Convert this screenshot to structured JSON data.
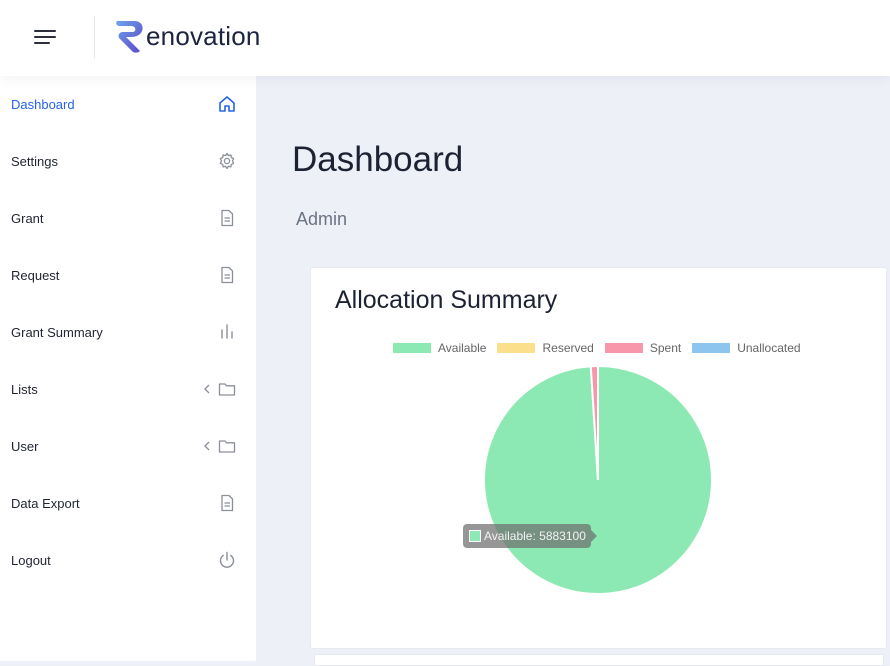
{
  "brand": {
    "logo_letter": "R",
    "name_rest": "enovation"
  },
  "sidebar": {
    "items": [
      {
        "label": "Dashboard",
        "icon": "home-icon",
        "active": true
      },
      {
        "label": "Settings",
        "icon": "gear-icon"
      },
      {
        "label": "Grant",
        "icon": "document-icon"
      },
      {
        "label": "Request",
        "icon": "document-icon"
      },
      {
        "label": "Grant Summary",
        "icon": "bar-chart-icon"
      },
      {
        "label": "Lists",
        "icon": "folder-icon",
        "has_chevron": true
      },
      {
        "label": "User",
        "icon": "folder-icon",
        "has_chevron": true
      },
      {
        "label": "Data Export",
        "icon": "document-icon"
      },
      {
        "label": "Logout",
        "icon": "power-icon"
      }
    ]
  },
  "page": {
    "title": "Dashboard",
    "subtitle": "Admin"
  },
  "colors": {
    "accent": "#2563eb",
    "background": "#edf0f7"
  },
  "card": {
    "title": "Allocation Summary",
    "tooltip": "Available: 5883100"
  },
  "chart_data": {
    "type": "pie",
    "title": "Allocation Summary",
    "categories": [
      "Available",
      "Reserved",
      "Spent",
      "Unallocated"
    ],
    "values": [
      5883100,
      0,
      60000,
      0
    ],
    "colors": [
      "#8de9b3",
      "#fbdf8a",
      "#f797a9",
      "#8ec5ee"
    ],
    "legend_position": "top",
    "tooltip_label": "Available: 5883100"
  }
}
